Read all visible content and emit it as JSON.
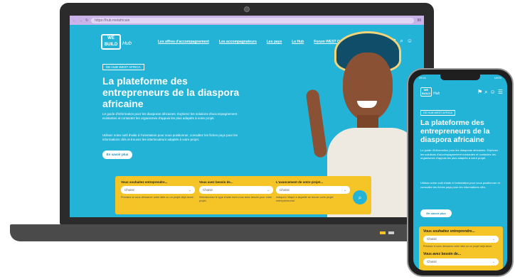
{
  "browser": {
    "nav_back": "←",
    "nav_forward": "→",
    "nav_reload": "↻",
    "url": "https://hub.metafricain",
    "url_badge": "88"
  },
  "site": {
    "logo_text": "WE BUILD",
    "logo_sub": "Hub",
    "nav": [
      "Les offres d'accompagnement",
      "Les accompagnateurs",
      "Les pays",
      "Le Hub",
      "Forum WEST Online"
    ],
    "icons": [
      "flag-icon",
      "search-icon",
      "user-icon"
    ]
  },
  "hero": {
    "breadcrumb": "DE HUB WEST AFRICA",
    "title": "La plateforme des entrepreneurs de la diaspora africaine",
    "body": "Le guide d'information pour les diasporas africaines. Explorez les solutions d'accompagnement existantes et contactez les organismes d'appuis les plus adaptés à votre projet.",
    "body2": "Utilisez notre outil d'aide à l'orientation pour vous positionner, consultez les fiches pays pour les informations clés et trouvez les interlocuteurs adaptés à votre projet.",
    "cta": "En savoir plus"
  },
  "search": {
    "fields": [
      {
        "label": "Vous souhaitez entreprendre...",
        "value": "Choisir",
        "help": "Précisez si vous démarrez votre idée ou un projet déjà lancé."
      },
      {
        "label": "Vous avez besoin de...",
        "value": "Choisir",
        "help": "Sélectionnez le type d'aide dont vous avez besoin pour votre projet."
      },
      {
        "label": "L'avancement de votre projet...",
        "value": "Choisir",
        "help": "Indiquez l'étape à laquelle se trouve votre projet entrepreneurial."
      }
    ],
    "button_icon": "search-icon"
  },
  "phone": {
    "status_time": "09:41",
    "status_right": "100%",
    "breadcrumb": "DE HUB WEST AFRICA",
    "title": "La plateforme des entrepreneurs de la diaspora africaine",
    "body": "Le guide d'information pour les diasporas africaines. Explorez les solutions d'accompagnement existantes et contactez les organismes d'appuis les plus adaptés à votre projet.",
    "body2": "Utilisez notre outil d'aide à l'orientation pour vous positionner et consultez les fiches pays pour les informations clés.",
    "cta": "En savoir plus",
    "field1_label": "Vous souhaitez entreprendre...",
    "field1_value": "Choisir",
    "field1_help": "Précisez si vous démarrez votre idée ou un projet déjà lancé.",
    "field2_label": "Vous avez besoin de...",
    "field2_value": "Choisir"
  },
  "colors": {
    "brand_cyan": "#22b3d7",
    "brand_yellow": "#f5c528",
    "browser_bar": "#c9b3e8"
  }
}
